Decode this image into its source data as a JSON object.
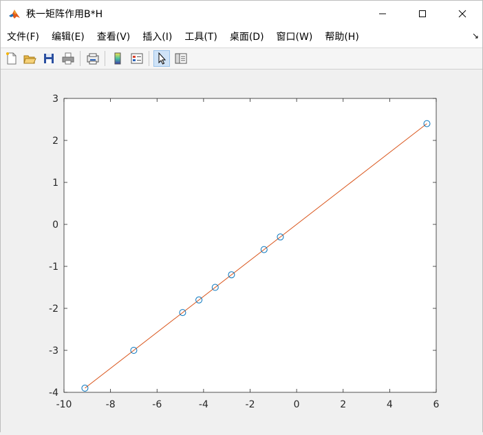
{
  "window": {
    "title": "秩一矩阵作用B*H",
    "controls": {
      "minimize": "—",
      "maximize": "☐",
      "close": "✕"
    }
  },
  "menu": {
    "items": [
      {
        "label": "文件(F)",
        "name": "menu-file"
      },
      {
        "label": "编辑(E)",
        "name": "menu-edit"
      },
      {
        "label": "查看(V)",
        "name": "menu-view"
      },
      {
        "label": "插入(I)",
        "name": "menu-insert"
      },
      {
        "label": "工具(T)",
        "name": "menu-tools"
      },
      {
        "label": "桌面(D)",
        "name": "menu-desktop"
      },
      {
        "label": "窗口(W)",
        "name": "menu-window"
      },
      {
        "label": "帮助(H)",
        "name": "menu-help"
      }
    ],
    "dock_arrow": "↘"
  },
  "toolbar": {
    "buttons": [
      "new-figure-icon",
      "open-file-icon",
      "save-icon",
      "print-icon",
      "link-plot-icon",
      "insert-colorbar-icon",
      "insert-legend-icon",
      "select-pointer-icon",
      "property-inspector-icon"
    ],
    "active": "select-pointer-icon"
  },
  "chart_data": {
    "type": "scatter",
    "xlim": [
      -10,
      6
    ],
    "ylim": [
      -4,
      3
    ],
    "xticks": [
      -10,
      -8,
      -6,
      -4,
      -2,
      0,
      2,
      4,
      6
    ],
    "yticks": [
      -4,
      -3,
      -2,
      -1,
      0,
      1,
      2,
      3
    ],
    "grid": false,
    "series": [
      {
        "kind": "markers",
        "marker": "circle",
        "color": "#0072BD",
        "x": [
          -9.1,
          -7.0,
          -4.9,
          -4.2,
          -3.5,
          -2.8,
          -1.4,
          -0.7,
          5.6
        ],
        "y": [
          -3.9,
          -3.0,
          -2.1,
          -1.8,
          -1.5,
          -1.2,
          -0.6,
          -0.3,
          2.4
        ]
      },
      {
        "kind": "line",
        "color": "#D95319",
        "x": [
          -9.1,
          5.6
        ],
        "y": [
          -3.9,
          2.4
        ]
      }
    ]
  }
}
